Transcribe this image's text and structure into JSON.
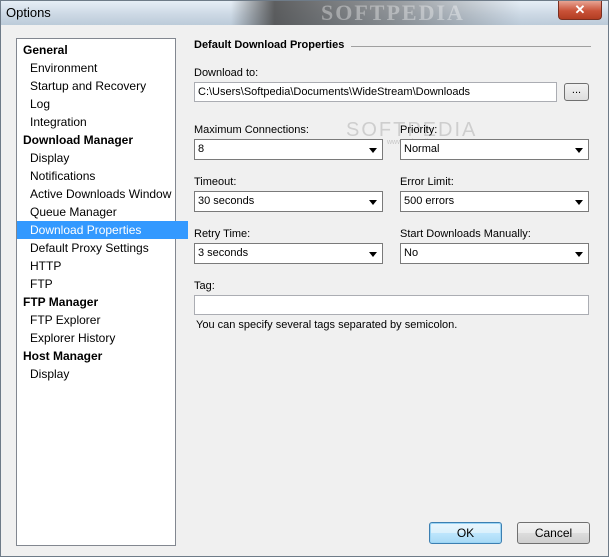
{
  "window": {
    "title": "Options",
    "close_glyph": "✕"
  },
  "watermark": {
    "banner": "SOFTPEDIA",
    "main": "SOFTPEDIA",
    "sub": "www.softpedia.com"
  },
  "sidebar": {
    "items": [
      {
        "label": "General",
        "type": "group"
      },
      {
        "label": "Environment",
        "type": "child"
      },
      {
        "label": "Startup and Recovery",
        "type": "child"
      },
      {
        "label": "Log",
        "type": "child"
      },
      {
        "label": "Integration",
        "type": "child"
      },
      {
        "label": "Download Manager",
        "type": "group"
      },
      {
        "label": "Display",
        "type": "child"
      },
      {
        "label": "Notifications",
        "type": "child"
      },
      {
        "label": "Active Downloads Window",
        "type": "child"
      },
      {
        "label": "Queue Manager",
        "type": "child"
      },
      {
        "label": "Download Properties",
        "type": "child",
        "selected": true
      },
      {
        "label": "Default Proxy Settings",
        "type": "child"
      },
      {
        "label": "HTTP",
        "type": "child"
      },
      {
        "label": "FTP",
        "type": "child"
      },
      {
        "label": "FTP Manager",
        "type": "group"
      },
      {
        "label": "FTP Explorer",
        "type": "child"
      },
      {
        "label": "Explorer History",
        "type": "child"
      },
      {
        "label": "Host Manager",
        "type": "group"
      },
      {
        "label": "Display",
        "type": "child"
      }
    ]
  },
  "main": {
    "section_title": "Default Download Properties",
    "download_to": {
      "label": "Download to:",
      "value": "C:\\Users\\Softpedia\\Documents\\WideStream\\Downloads",
      "browse_label": "..."
    },
    "max_connections": {
      "label": "Maximum Connections:",
      "value": "8"
    },
    "priority": {
      "label": "Priority:",
      "value": "Normal"
    },
    "timeout": {
      "label": "Timeout:",
      "value": "30 seconds"
    },
    "error_limit": {
      "label": "Error Limit:",
      "value": "500 errors"
    },
    "retry_time": {
      "label": "Retry Time:",
      "value": "3 seconds"
    },
    "start_manually": {
      "label": "Start Downloads Manually:",
      "value": "No"
    },
    "tag": {
      "label": "Tag:",
      "value": "",
      "hint": "You can specify several tags separated by semicolon."
    }
  },
  "footer": {
    "ok_label": "OK",
    "cancel_label": "Cancel"
  },
  "colors": {
    "selection": "#3399ff",
    "dialog_bg": "#f0f0f0",
    "close_button": "#c95238"
  }
}
